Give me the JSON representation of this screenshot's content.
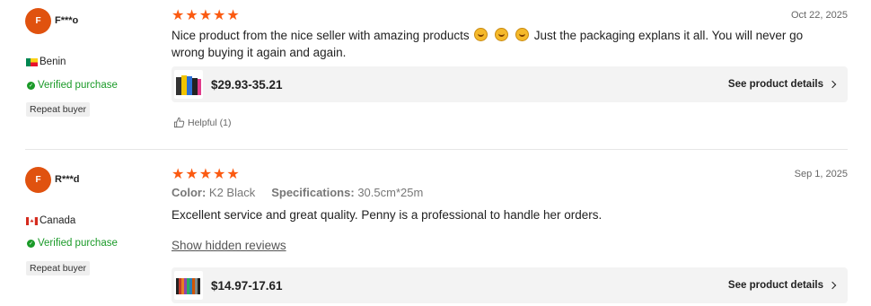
{
  "reviews": [
    {
      "avatar_letter": "F",
      "name": "F***o",
      "country": "Benin",
      "verified_label": "Verified purchase",
      "repeat_label": "Repeat buyer",
      "rating": 5,
      "date": "Oct 22, 2025",
      "text_part1": "Nice product from the nice seller with amazing products",
      "text_part2": "Just the packaging explans it all. You will never go wrong buying it again and again.",
      "emoji_count": 3,
      "price": "$29.93-35.21",
      "details_label": "See product details",
      "helpful_label": "Helpful (1)"
    },
    {
      "avatar_letter": "F",
      "name": "R***d",
      "country": "Canada",
      "verified_label": "Verified purchase",
      "repeat_label": "Repeat buyer",
      "rating": 5,
      "date": "Sep 1, 2025",
      "color_key": "Color:",
      "color_val": "K2 Black",
      "spec_key": "Specifications:",
      "spec_val": "30.5cm*25m",
      "text": "Excellent service and great quality. Penny is a professional to handle her orders.",
      "show_hidden_label": "Show hidden reviews",
      "price": "$14.97-17.61",
      "details_label": "See product details"
    }
  ],
  "colors": {
    "accent": "#fb5a11",
    "avatar": "#e0520f",
    "verified": "#1a9a28"
  }
}
